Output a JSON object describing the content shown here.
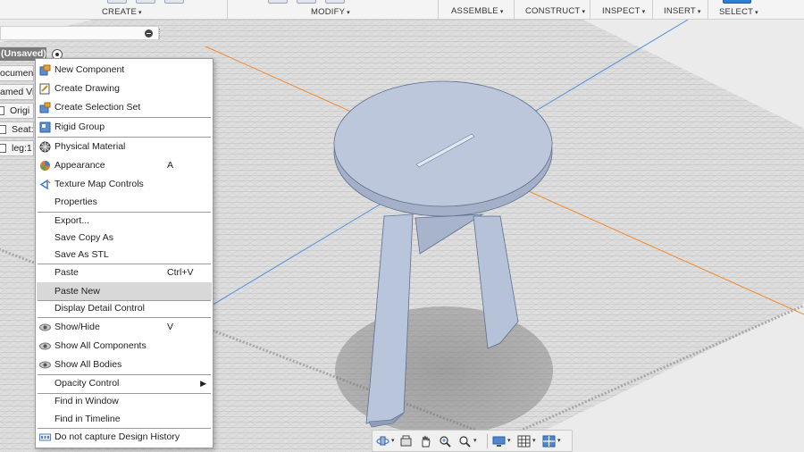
{
  "toolbar": {
    "create": "CREATE",
    "modify": "MODIFY",
    "assemble": "ASSEMBLE",
    "construct": "CONSTRUCT",
    "inspect": "INSPECT",
    "insert": "INSERT",
    "select": "SELECT",
    "dropdown_glyph": "▾"
  },
  "browser": {
    "document_title": "(Unsaved)",
    "items": [
      {
        "label": "ocument",
        "icon": "settings-icon"
      },
      {
        "label": "amed Vie",
        "icon": "folder-icon"
      },
      {
        "label": "Origi",
        "icon": "origin-icon"
      },
      {
        "label": "Seat:",
        "icon": "component-icon"
      },
      {
        "label": "leg:1",
        "icon": "component-icon"
      }
    ]
  },
  "context_menu": {
    "items": [
      {
        "label": "New Component",
        "icon": "new-component-icon"
      },
      {
        "label": "Create Drawing",
        "icon": "create-drawing-icon"
      },
      {
        "label": "Create Selection Set",
        "icon": "selection-set-icon"
      },
      {
        "label": "Rigid Group",
        "icon": "rigid-group-icon"
      },
      {
        "label": "Physical Material",
        "icon": "physical-material-icon"
      },
      {
        "label": "Appearance",
        "icon": "appearance-icon",
        "shortcut": "A"
      },
      {
        "label": "Texture Map Controls",
        "icon": "texture-map-icon"
      },
      {
        "label": "Properties"
      },
      {
        "label": "Export..."
      },
      {
        "label": "Save Copy As"
      },
      {
        "label": "Save As STL"
      },
      {
        "label": "Paste",
        "shortcut": "Ctrl+V"
      },
      {
        "label": "Paste New",
        "highlighted": true
      },
      {
        "label": "Display Detail Control"
      },
      {
        "label": "Show/Hide",
        "icon": "eye-icon",
        "shortcut": "V"
      },
      {
        "label": "Show All Components",
        "icon": "eye-icon"
      },
      {
        "label": "Show All Bodies",
        "icon": "eye-icon"
      },
      {
        "label": "Opacity Control",
        "submenu_glyph": "▶"
      },
      {
        "label": "Find in Window"
      },
      {
        "label": "Find in Timeline"
      },
      {
        "label": "Do not capture Design History",
        "icon": "design-history-icon"
      }
    ]
  },
  "navbar": {
    "dropdown_glyph": "▾",
    "tools": [
      "orbit-icon",
      "look-at-icon",
      "pan-icon",
      "zoom-icon",
      "zoom-window-icon",
      "display-settings-icon",
      "grid-settings-icon",
      "viewports-icon"
    ]
  },
  "colors": {
    "model_face": "#b7c3d9",
    "model_edge": "#5f6f8e",
    "highlight": "#d8d8d8",
    "axis_orange": "#f08a2c",
    "axis_blue": "#4a8fe0"
  }
}
